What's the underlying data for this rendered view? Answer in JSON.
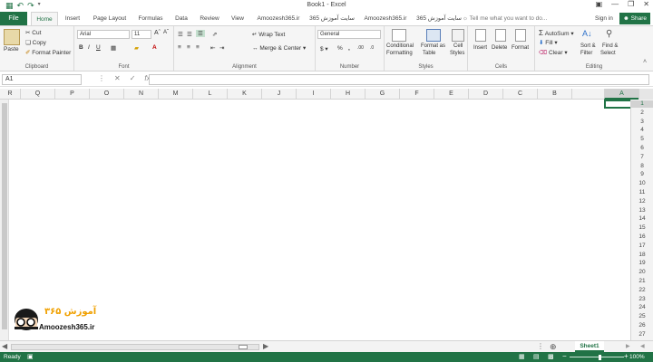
{
  "window": {
    "title": "Book1 - Excel"
  },
  "tabs": [
    {
      "label": "File"
    },
    {
      "label": "Home"
    },
    {
      "label": "Insert"
    },
    {
      "label": "Page Layout"
    },
    {
      "label": "Formulas"
    },
    {
      "label": "Data"
    },
    {
      "label": "Review"
    },
    {
      "label": "View"
    },
    {
      "label": "Amoozesh365.ir"
    },
    {
      "label": "سایت آموزش 365"
    },
    {
      "label": "Amoozesh365.ir"
    },
    {
      "label": "سایت آموزش 365"
    }
  ],
  "tell_me": "Tell me what you want to do...",
  "sign_in": "Sign in",
  "share": "Share",
  "clipboard": {
    "paste": "Paste",
    "cut": "Cut",
    "copy": "Copy",
    "format_painter": "Format Painter",
    "group": "Clipboard"
  },
  "font": {
    "name": "Arial",
    "size": "11",
    "group": "Font"
  },
  "alignment": {
    "wrap": "Wrap Text",
    "merge": "Merge & Center",
    "group": "Alignment"
  },
  "number": {
    "format": "General",
    "group": "Number"
  },
  "styles": {
    "cond1": "Conditional",
    "cond2": "Formatting",
    "fmt1": "Format as",
    "fmt2": "Table",
    "cell1": "Cell",
    "cell2": "Styles",
    "group": "Styles"
  },
  "cells": {
    "insert": "Insert",
    "delete": "Delete",
    "format": "Format",
    "group": "Cells"
  },
  "editing": {
    "autosum": "AutoSum",
    "fill": "Fill",
    "clear": "Clear",
    "sort1": "Sort &",
    "sort2": "Filter",
    "find1": "Find &",
    "find2": "Select",
    "group": "Editing"
  },
  "namebox": "A1",
  "fx": "fx",
  "columns": [
    "R",
    "Q",
    "P",
    "O",
    "N",
    "M",
    "L",
    "K",
    "J",
    "I",
    "H",
    "G",
    "F",
    "E",
    "D",
    "C",
    "B",
    "A"
  ],
  "rows": [
    "1",
    "2",
    "3",
    "4",
    "5",
    "6",
    "7",
    "8",
    "9",
    "10",
    "11",
    "12",
    "13",
    "14",
    "15",
    "16",
    "17",
    "18",
    "19",
    "20",
    "21",
    "22",
    "23",
    "24",
    "25",
    "26",
    "27"
  ],
  "logo": {
    "persian": "آموزش ۳۶۵",
    "url": "Amoozesh365.ir"
  },
  "sheet": "Sheet1",
  "status": {
    "ready": "Ready",
    "zoom": "100%"
  }
}
